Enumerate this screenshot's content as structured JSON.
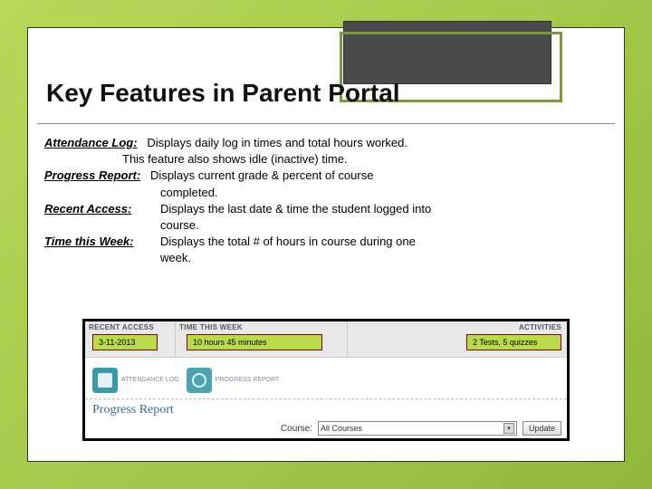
{
  "title": "Key Features in Parent Portal",
  "features": {
    "attendance_log": {
      "label": "Attendance Log:",
      "desc1": "Displays daily log in times and total hours worked.",
      "desc2": "This feature also shows idle (inactive) time."
    },
    "progress_report": {
      "label": "Progress Report:",
      "desc1": "Displays current grade & percent of course",
      "desc2": "completed."
    },
    "recent_access": {
      "label": "Recent Access:",
      "desc1": "Displays the last date & time the student logged into",
      "desc2": "course."
    },
    "time_week": {
      "label": "Time this Week:",
      "desc1": "Displays the total # of hours in course during one",
      "desc2": "week."
    }
  },
  "screenshot": {
    "headers": {
      "recent_access": "RECENT ACCESS",
      "time_this_week": "TIME THIS WEEK",
      "activities": "ACTIVITIES"
    },
    "values": {
      "recent_access": "3-11-2013",
      "time_this_week": "10 hours 45 minutes",
      "activities": "2 Tests, 5 quizzes"
    },
    "icons": {
      "attendance": "ATTENDANCE\nLOG",
      "progress": "PROGRESS\nREPORT"
    },
    "pr_title": "Progress Report",
    "course_label": "Course:",
    "course_value": "All Courses",
    "update_label": "Update"
  }
}
